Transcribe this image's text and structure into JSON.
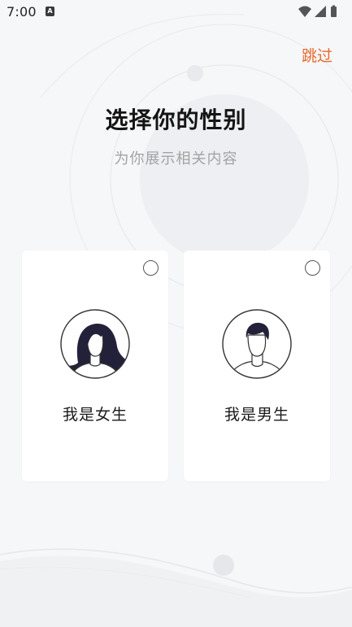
{
  "status_bar": {
    "time": "7:00",
    "notification_icon": "A"
  },
  "header": {
    "skip_label": "跳过"
  },
  "main": {
    "title": "选择你的性别",
    "subtitle": "为你展示相关内容"
  },
  "options": [
    {
      "label": "我是女生",
      "icon": "female-avatar-icon"
    },
    {
      "label": "我是男生",
      "icon": "male-avatar-icon"
    }
  ],
  "colors": {
    "accent": "#e86a2c",
    "background": "#f6f7f9",
    "title": "#151515",
    "subtitle": "#a3a3a3"
  }
}
